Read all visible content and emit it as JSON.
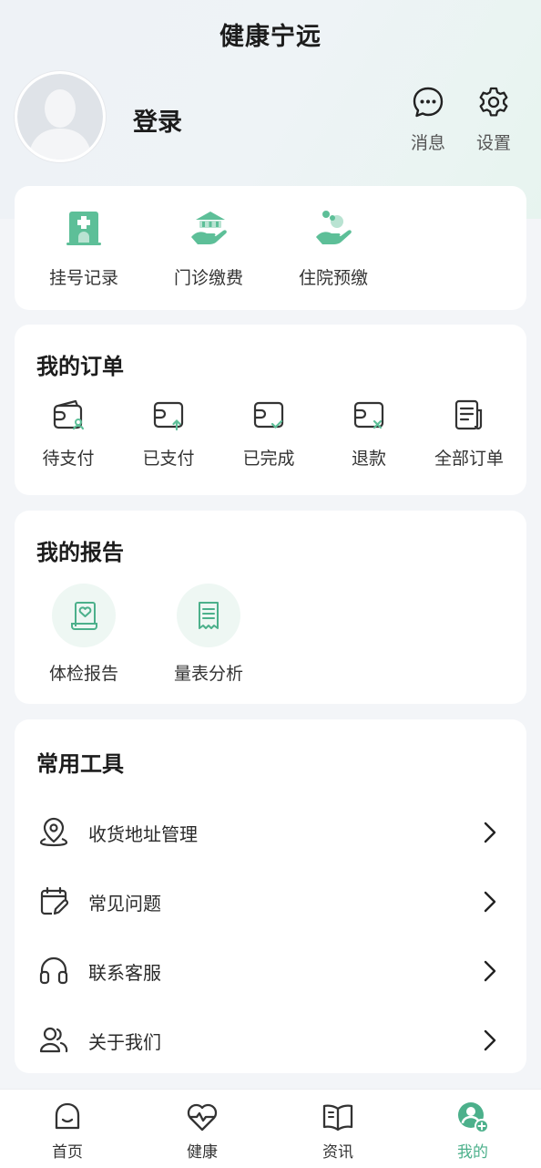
{
  "app": {
    "title": "健康宁远"
  },
  "header": {
    "login_label": "登录",
    "messages_label": "消息",
    "settings_label": "设置"
  },
  "quick_actions": [
    {
      "label": "挂号记录",
      "icon": "hospital-icon"
    },
    {
      "label": "门诊缴费",
      "icon": "hand-payment-icon"
    },
    {
      "label": "住院预缴",
      "icon": "hand-care-icon"
    }
  ],
  "orders": {
    "title": "我的订单",
    "items": [
      {
        "label": "待支付",
        "icon": "wallet-pending-icon"
      },
      {
        "label": "已支付",
        "icon": "wallet-paid-icon"
      },
      {
        "label": "已完成",
        "icon": "wallet-done-icon"
      },
      {
        "label": "退款",
        "icon": "wallet-refund-icon"
      },
      {
        "label": "全部订单",
        "icon": "all-orders-icon"
      }
    ]
  },
  "reports": {
    "title": "我的报告",
    "items": [
      {
        "label": "体检报告",
        "icon": "health-report-icon"
      },
      {
        "label": "量表分析",
        "icon": "scale-analysis-icon"
      }
    ]
  },
  "tools": {
    "title": "常用工具",
    "items": [
      {
        "label": "收货地址管理",
        "icon": "location-icon"
      },
      {
        "label": "常见问题",
        "icon": "faq-icon"
      },
      {
        "label": "联系客服",
        "icon": "headset-icon"
      },
      {
        "label": "关于我们",
        "icon": "users-icon"
      }
    ]
  },
  "tabs": [
    {
      "label": "首页",
      "icon": "home-icon"
    },
    {
      "label": "健康",
      "icon": "heart-pulse-icon"
    },
    {
      "label": "资讯",
      "icon": "book-icon"
    },
    {
      "label": "我的",
      "icon": "profile-icon",
      "active": true
    }
  ],
  "colors": {
    "accent": "#4cb08b",
    "accent_light": "#eef7f3",
    "background": "#f3f5f8"
  }
}
